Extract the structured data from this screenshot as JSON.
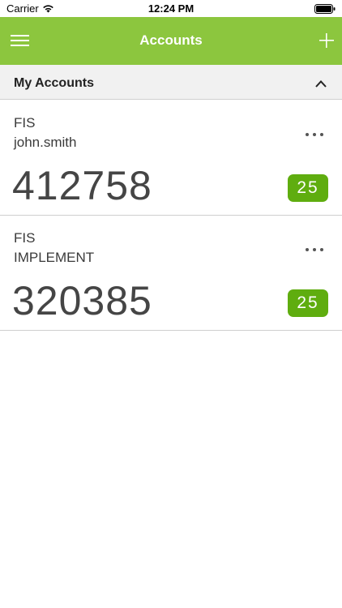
{
  "status_bar": {
    "carrier": "Carrier",
    "time": "12:24 PM",
    "icons": [
      "wifi-icon",
      "battery-icon"
    ]
  },
  "nav": {
    "title": "Accounts",
    "left_icon": "hamburger-menu-icon",
    "right_icon": "plus-icon",
    "color": "#8cc63e"
  },
  "section": {
    "title": "My Accounts",
    "toggle_icon": "chevron-up-icon"
  },
  "accounts": [
    {
      "issuer": "FIS",
      "user": "john.smith",
      "code": "412758",
      "seconds": "25"
    },
    {
      "issuer": "FIS",
      "user": "IMPLEMENT",
      "code": "320385",
      "seconds": "25"
    }
  ],
  "badge_color": "#5fad0f"
}
